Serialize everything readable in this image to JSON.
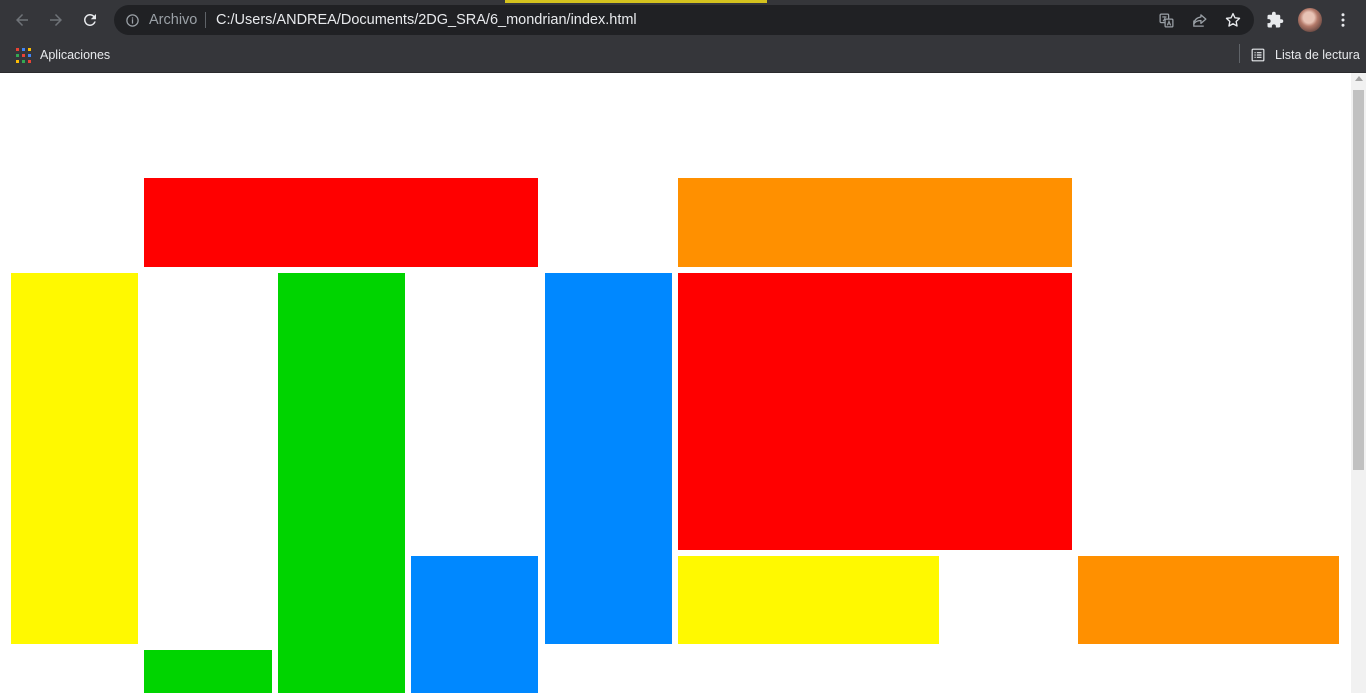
{
  "browser": {
    "omnibox": {
      "scheme_label": "Archivo",
      "url": "C:/Users/ANDREA/Documents/2DG_SRA/6_mondrian/index.html"
    },
    "icons": {
      "back": "back-arrow-icon",
      "forward": "forward-arrow-icon",
      "reload": "reload-icon",
      "site_info": "info-icon",
      "translate": "translate-icon",
      "share": "share-icon",
      "bookmark": "star-icon",
      "extensions": "puzzle-icon",
      "profile": "avatar",
      "menu": "kebab-menu-icon"
    },
    "bookmarks_bar": {
      "apps_label": "Aplicaciones",
      "reading_list_label": "Lista de lectura"
    }
  },
  "page": {
    "palette": {
      "red": "#ff0000",
      "orange": "#ff9000",
      "yellow": "#fff900",
      "green": "#00d400",
      "blue": "#0088ff",
      "background": "#ffffff"
    },
    "blocks": [
      {
        "name": "red-block-top",
        "color": "red"
      },
      {
        "name": "orange-block-top",
        "color": "orange"
      },
      {
        "name": "yellow-block-left",
        "color": "yellow"
      },
      {
        "name": "green-block-tall",
        "color": "green"
      },
      {
        "name": "blue-block-middle",
        "color": "blue"
      },
      {
        "name": "red-block-large",
        "color": "red"
      },
      {
        "name": "blue-block-small",
        "color": "blue"
      },
      {
        "name": "yellow-block-bottom",
        "color": "yellow"
      },
      {
        "name": "orange-block-right",
        "color": "orange"
      },
      {
        "name": "green-block-small",
        "color": "green"
      }
    ]
  }
}
